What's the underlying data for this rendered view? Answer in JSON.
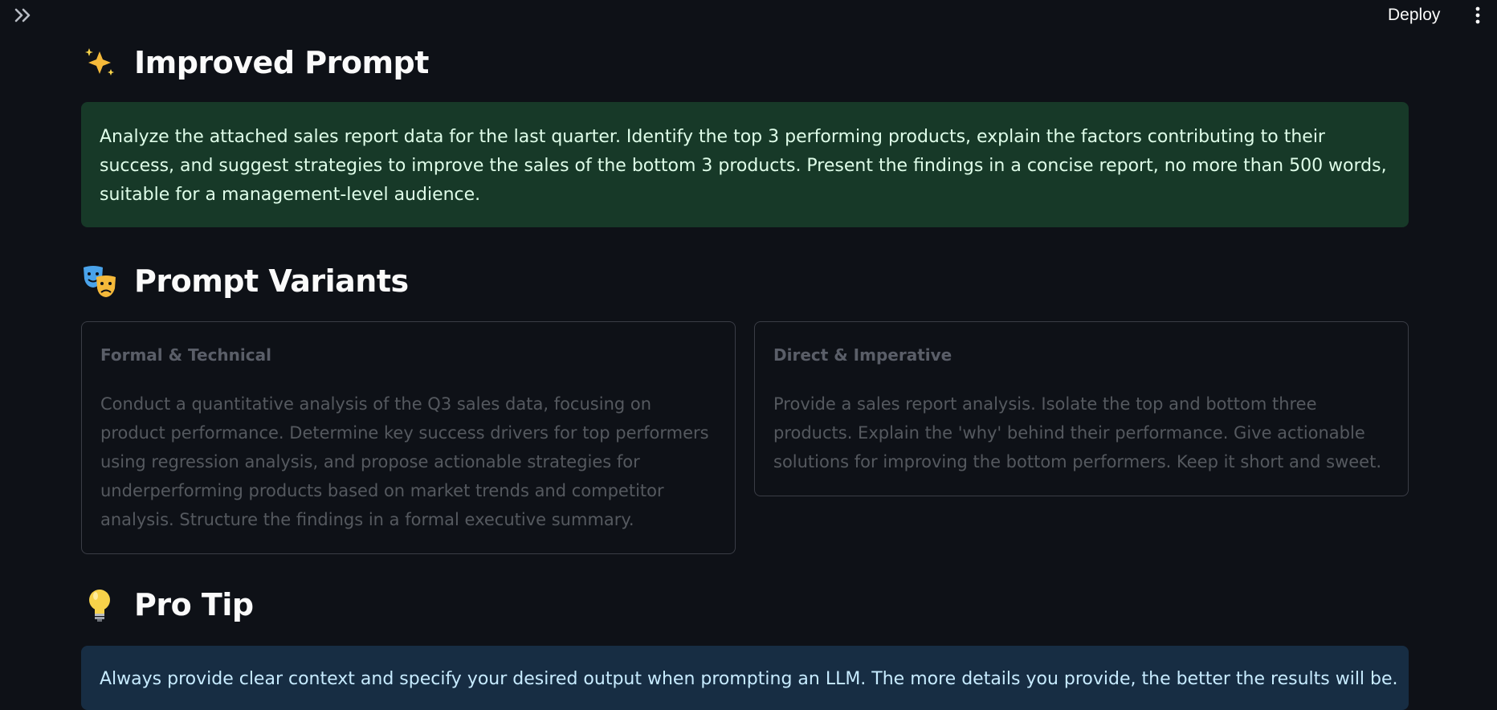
{
  "header": {
    "deploy_label": "Deploy"
  },
  "icons": {
    "sidebar_toggle": "double-chevron-right-icon",
    "menu": "vertical-ellipsis-icon",
    "improved_prompt": "sparkles-icon",
    "prompt_variants": "performing-arts-icon",
    "pro_tip": "light-bulb-icon"
  },
  "improved_prompt": {
    "heading": "Improved Prompt",
    "text": "Analyze the attached sales report data for the last quarter. Identify the top 3 performing products, explain the factors contributing to their success, and suggest strategies to improve the sales of the bottom 3 products. Present the findings in a concise report, no more than 500 words, suitable for a management-level audience."
  },
  "prompt_variants": {
    "heading": "Prompt Variants",
    "variants": [
      {
        "title": "Formal & Technical",
        "text": "Conduct a quantitative analysis of the Q3 sales data, focusing on product performance. Determine key success drivers for top performers using regression analysis, and propose actionable strategies for underperforming products based on market trends and competitor analysis. Structure the findings in a formal executive summary."
      },
      {
        "title": "Direct & Imperative",
        "text": "Provide a sales report analysis. Isolate the top and bottom three products. Explain the 'why' behind their performance. Give actionable solutions for improving the bottom performers. Keep it short and sweet."
      }
    ]
  },
  "pro_tip": {
    "heading": "Pro Tip",
    "text": "Always provide clear context and specify your desired output when prompting an LLM. The more details you provide, the better the results will be."
  },
  "colors": {
    "background": "#0e1117",
    "success_box": "#173928",
    "info_box": "#172d43",
    "card_border": "#3a3d46"
  }
}
